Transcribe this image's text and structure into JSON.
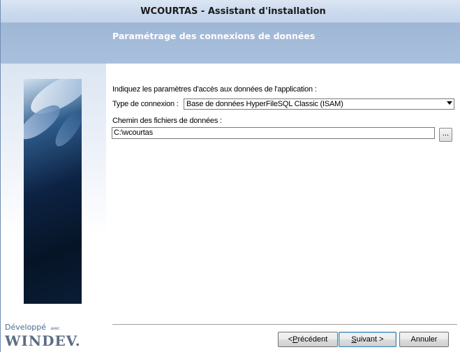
{
  "window": {
    "title": "WCOURTAS - Assistant d'installation"
  },
  "banner": {
    "heading": "Paramétrage des connexions de données"
  },
  "sidebar": {
    "logo_line1": "Développé",
    "logo_avec": "avec",
    "logo_brand": "WINDEV."
  },
  "form": {
    "instruction": "Indiquez les paramètres d'accès aux données de l'application :",
    "connection_label": "Type de connexion :",
    "connection_value": "Base de données HyperFileSQL Classic (ISAM)",
    "path_label": "Chemin des fichiers de données :",
    "path_value": "C:\\wcourtas",
    "browse_label": "..."
  },
  "buttons": {
    "previous_prefix": "< ",
    "previous_mnemonic": "P",
    "previous_rest": "récédent",
    "next_mnemonic": "S",
    "next_rest": "uivant >",
    "cancel": "Annuler"
  },
  "colors": {
    "banner": "#a3bbd9",
    "titlebar": "#cddbee",
    "default_button_border": "#3c7fb1"
  }
}
